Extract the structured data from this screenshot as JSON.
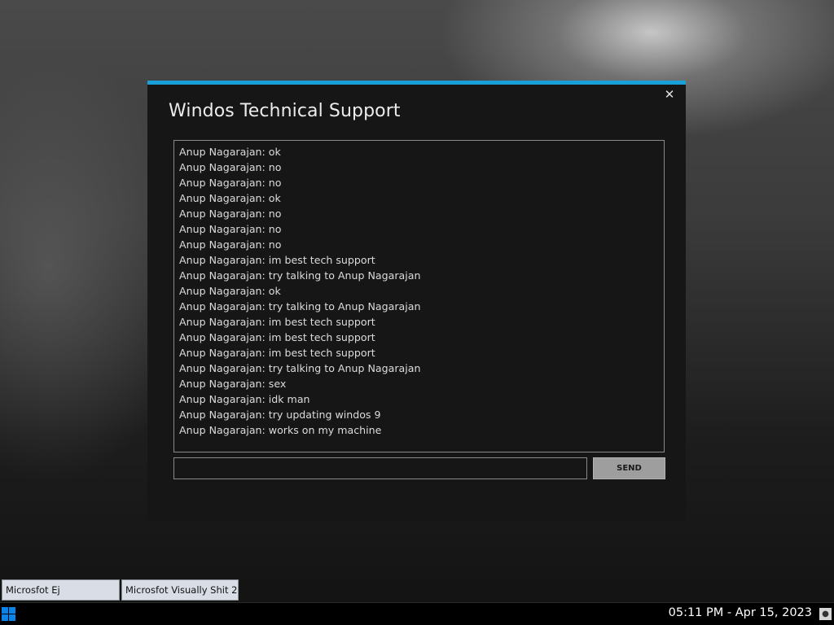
{
  "dialog": {
    "title": "Windos Technical Support",
    "close_icon": "close-icon",
    "accent_color": "#19a0d8",
    "messages": [
      "Anup Nagarajan: ok",
      "Anup Nagarajan: no",
      "Anup Nagarajan: no",
      "Anup Nagarajan: ok",
      "Anup Nagarajan: no",
      "Anup Nagarajan: no",
      "Anup Nagarajan: no",
      "Anup Nagarajan: im best tech support",
      "Anup Nagarajan: try talking to Anup Nagarajan",
      "Anup Nagarajan: ok",
      "Anup Nagarajan: try talking to Anup Nagarajan",
      "Anup Nagarajan: im best tech support",
      "Anup Nagarajan: im best tech support",
      "Anup Nagarajan: im best tech support",
      "Anup Nagarajan: try talking to Anup Nagarajan",
      "Anup Nagarajan: sex",
      "Anup Nagarajan: idk man",
      "Anup Nagarajan: try updating windos 9",
      "Anup Nagarajan: works on my machine"
    ],
    "input_value": "",
    "send_label": "SEND"
  },
  "taskbar": {
    "windows": [
      "Microsfot Ej",
      "Microsfot Visually Shit 2..."
    ],
    "clock": "05:11 PM - Apr 15, 2023",
    "start_icon": "windows-logo-icon",
    "tray_icon": "notification-icon"
  }
}
